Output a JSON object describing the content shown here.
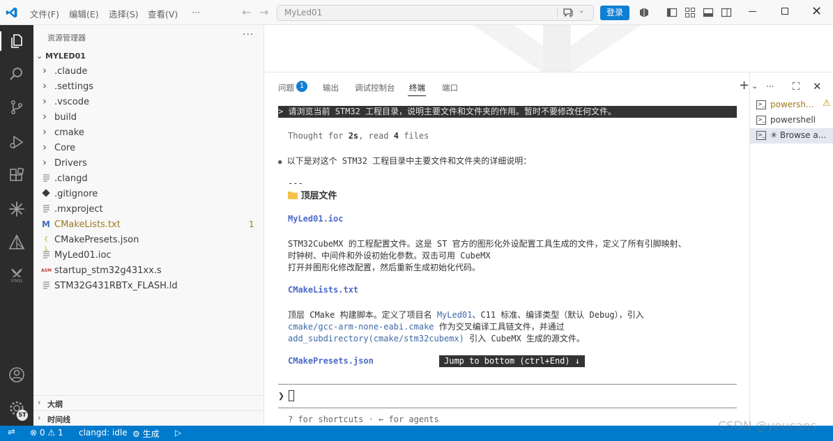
{
  "titlebar": {
    "menu": [
      "文件(F)",
      "编辑(E)",
      "选择(S)",
      "查看(V)",
      "···"
    ],
    "command_center": "MyLed01",
    "login": "登录"
  },
  "sidebar": {
    "title": "资源管理器",
    "more": "···",
    "root": "MYLED01",
    "items": [
      {
        "name": ".claude",
        "kind": "folder",
        "icon": "chevron-right-icon"
      },
      {
        "name": ".settings",
        "kind": "folder",
        "icon": "chevron-right-icon"
      },
      {
        "name": ".vscode",
        "kind": "folder",
        "icon": "chevron-right-icon"
      },
      {
        "name": "build",
        "kind": "folder",
        "icon": "chevron-right-icon"
      },
      {
        "name": "cmake",
        "kind": "folder",
        "icon": "chevron-right-icon"
      },
      {
        "name": "Core",
        "kind": "folder",
        "icon": "chevron-right-icon"
      },
      {
        "name": "Drivers",
        "kind": "folder",
        "icon": "chevron-right-icon"
      },
      {
        "name": ".clangd",
        "kind": "file",
        "icon": "file-lines-icon"
      },
      {
        "name": ".gitignore",
        "kind": "file",
        "icon": "git-icon"
      },
      {
        "name": ".mxproject",
        "kind": "file",
        "icon": "file-lines-icon"
      },
      {
        "name": "CMakeLists.txt",
        "kind": "file",
        "icon": "cmake-m-icon",
        "badge": "1",
        "color": "#9b7a19"
      },
      {
        "name": "CMakePresets.json",
        "kind": "file",
        "icon": "json-braces-icon"
      },
      {
        "name": "MyLed01.ioc",
        "kind": "file",
        "icon": "file-lines-icon"
      },
      {
        "name": "startup_stm32g431xx.s",
        "kind": "file",
        "icon": "asm-icon"
      },
      {
        "name": "STM32G431RBTx_FLASH.ld",
        "kind": "file",
        "icon": "file-lines-icon"
      }
    ],
    "outline": "大纲",
    "timeline": "时间线"
  },
  "panel": {
    "tabs": [
      {
        "label": "问题",
        "badge": "1"
      },
      {
        "label": "输出"
      },
      {
        "label": "调试控制台"
      },
      {
        "label": "终端",
        "active": true
      },
      {
        "label": "端口"
      }
    ],
    "actions": [
      "+",
      "⌄",
      "···",
      "⛶",
      "✕"
    ]
  },
  "terminal": {
    "prompt_marker": ">",
    "user_prompt": "请浏览当前 STM32 工程目录，说明主要文件和文件夹的作用。暂时不要修改任何文件。",
    "thought_prefix": "Thought for ",
    "thought_time": "2s",
    "thought_mid": ", read ",
    "thought_count": "4",
    "thought_suffix": " files",
    "bullet": "●",
    "intro": "以下是对这个 STM32 工程目录中主要文件和文件夹的详细说明：",
    "hr_text": "---",
    "section_heading": "顶层文件",
    "file1": "MyLed01.ioc",
    "file1_desc_1": "STM32CubeMX 的工程配置文件。这是 ST 官方的图形化外设配置工具生成的文件，定义了所有引脚映射、",
    "file1_desc_2": "时钟树、中间件和外设初始化参数。双击可用 CubeMX",
    "file1_desc_3": "打开并图形化修改配置，然后重新生成初始化代码。",
    "file2": "CMakeLists.txt",
    "file2_desc_1a": "顶层 CMake 构建脚本。定义了项目名 ",
    "file2_desc_1b": "MyLed01",
    "file2_desc_1c": "、C11 标准、编译类型（默认 Debug），引入",
    "file2_desc_2a": "cmake/gcc-arm-none-eabi.cmake",
    "file2_desc_2b": " 作为交叉编译工具链文件，并通过",
    "file2_desc_3a": "add_subdirectory(cmake/stm32cubemx)",
    "file2_desc_3b": " 引入 CubeMX 生成的源文件。",
    "file3": "CMakePresets.json",
    "jump": "Jump to bottom (ctrl+End) ↓",
    "input_marker": "❯",
    "hint": "? for shortcuts · ← for agents"
  },
  "terminal_list": [
    {
      "name": "powersh...",
      "warn": "⚠"
    },
    {
      "name": "powershell"
    },
    {
      "name": "✳ Browse a..."
    }
  ],
  "statusbar": {
    "errors": "0",
    "warnings": "1",
    "clangd": "clangd: idle",
    "build": "生成"
  },
  "watermark": "CSDN @youcans",
  "colors": {
    "accent": "#007acc",
    "activitybar": "#2c2c2c",
    "login": "#0f7fd4"
  }
}
